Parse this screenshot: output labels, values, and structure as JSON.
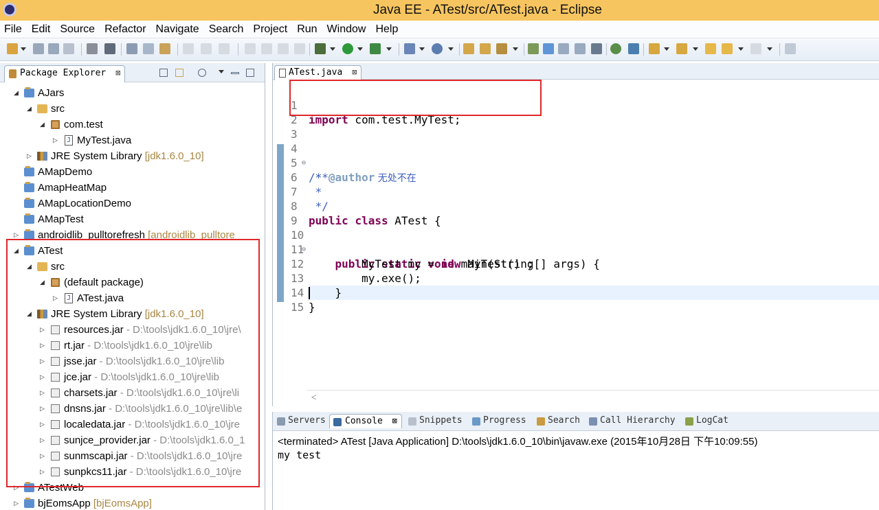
{
  "window": {
    "title": "Java EE - ATest/src/ATest.java - Eclipse"
  },
  "menu": [
    "File",
    "Edit",
    "Source",
    "Refactor",
    "Navigate",
    "Search",
    "Project",
    "Run",
    "Window",
    "Help"
  ],
  "package_explorer": {
    "tab_label": "Package Explorer",
    "close_glyph": "⊠",
    "tree": [
      {
        "label": "AJars",
        "deco": "",
        "path": ""
      },
      {
        "label": "src",
        "deco": "",
        "path": ""
      },
      {
        "label": "com.test",
        "deco": "",
        "path": ""
      },
      {
        "label": "MyTest.java",
        "deco": "",
        "path": ""
      },
      {
        "label": "JRE System Library",
        "deco": " [jdk1.6.0_10]",
        "path": ""
      },
      {
        "label": "AMapDemo",
        "deco": "",
        "path": ""
      },
      {
        "label": "AmapHeatMap",
        "deco": "",
        "path": ""
      },
      {
        "label": "AMapLocationDemo",
        "deco": "",
        "path": ""
      },
      {
        "label": "AMapTest",
        "deco": "",
        "path": ""
      },
      {
        "label": "androidlib_pulltorefresh",
        "deco": " [androidlib_pulltore",
        "path": ""
      },
      {
        "label": "ATest",
        "deco": "",
        "path": ""
      },
      {
        "label": "src",
        "deco": "",
        "path": ""
      },
      {
        "label": "(default package)",
        "deco": "",
        "path": ""
      },
      {
        "label": "ATest.java",
        "deco": "",
        "path": ""
      },
      {
        "label": "JRE System Library",
        "deco": " [jdk1.6.0_10]",
        "path": ""
      },
      {
        "label": "resources.jar",
        "deco": "",
        "path": " - D:\\tools\\jdk1.6.0_10\\jre\\"
      },
      {
        "label": "rt.jar",
        "deco": "",
        "path": " - D:\\tools\\jdk1.6.0_10\\jre\\lib"
      },
      {
        "label": "jsse.jar",
        "deco": "",
        "path": " - D:\\tools\\jdk1.6.0_10\\jre\\lib"
      },
      {
        "label": "jce.jar",
        "deco": "",
        "path": " - D:\\tools\\jdk1.6.0_10\\jre\\lib"
      },
      {
        "label": "charsets.jar",
        "deco": "",
        "path": " - D:\\tools\\jdk1.6.0_10\\jre\\li"
      },
      {
        "label": "dnsns.jar",
        "deco": "",
        "path": " - D:\\tools\\jdk1.6.0_10\\jre\\lib\\e"
      },
      {
        "label": "localedata.jar",
        "deco": "",
        "path": " - D:\\tools\\jdk1.6.0_10\\jre"
      },
      {
        "label": "sunjce_provider.jar",
        "deco": "",
        "path": " - D:\\tools\\jdk1.6.0_1"
      },
      {
        "label": "sunmscapi.jar",
        "deco": "",
        "path": " - D:\\tools\\jdk1.6.0_10\\jre"
      },
      {
        "label": "sunpkcs11.jar",
        "deco": "",
        "path": " - D:\\tools\\jdk1.6.0_10\\jre"
      },
      {
        "label": "ATestWeb",
        "deco": "",
        "path": ""
      },
      {
        "label": "bjEomsApp",
        "deco": " [bjEomsApp]",
        "path": ""
      }
    ]
  },
  "editor": {
    "tab_label": "ATest.java",
    "close_glyph": "⊠",
    "lines": [
      {
        "n": "1",
        "fold": ""
      },
      {
        "n": "2",
        "fold": ""
      },
      {
        "n": "3",
        "fold": ""
      },
      {
        "n": "4",
        "fold": "⊖"
      },
      {
        "n": "5",
        "fold": ""
      },
      {
        "n": "6",
        "fold": ""
      },
      {
        "n": "7",
        "fold": ""
      },
      {
        "n": "8",
        "fold": ""
      },
      {
        "n": "9",
        "fold": ""
      },
      {
        "n": "10",
        "fold": "⊖"
      },
      {
        "n": "11",
        "fold": ""
      },
      {
        "n": "12",
        "fold": ""
      },
      {
        "n": "13",
        "fold": ""
      },
      {
        "n": "14",
        "fold": ""
      },
      {
        "n": "15",
        "fold": ""
      }
    ],
    "code": {
      "l1_kw": "import",
      "l1_rest": " com.test.MyTest;",
      "l4": "/**",
      "l5_star": " * ",
      "l5_tag": "@author",
      "l5_text": " 无处不在",
      "l6": " *",
      "l7": " */",
      "l8_kw1": "public",
      "l8_sp": " ",
      "l8_kw2": "class",
      "l8_rest": " ATest {",
      "l10_indent": "    ",
      "l10_kw1": "public",
      "l10_kw2": "static",
      "l10_kw3": "void",
      "l10_rest": " main(String[] args) {",
      "l11_a": "        MyTest my = ",
      "l11_kw": "new",
      "l11_b": " MyTest() ;",
      "l12": "        my.exe();",
      "l13": "    }",
      "l14": "}"
    },
    "hscroll_glyph": "<"
  },
  "console": {
    "tabs": [
      {
        "label": "Servers"
      },
      {
        "label": "Console"
      },
      {
        "label": "Snippets"
      },
      {
        "label": "Progress"
      },
      {
        "label": "Search"
      },
      {
        "label": "Call Hierarchy"
      },
      {
        "label": "LogCat"
      }
    ],
    "close_glyph": "⊠",
    "status": "<terminated> ATest [Java Application] D:\\tools\\jdk1.6.0_10\\bin\\javaw.exe (2015年10月28日 下午10:09:55)",
    "output": "my test"
  },
  "glyphs": {
    "expanded": "◢",
    "collapsed": "▷"
  }
}
